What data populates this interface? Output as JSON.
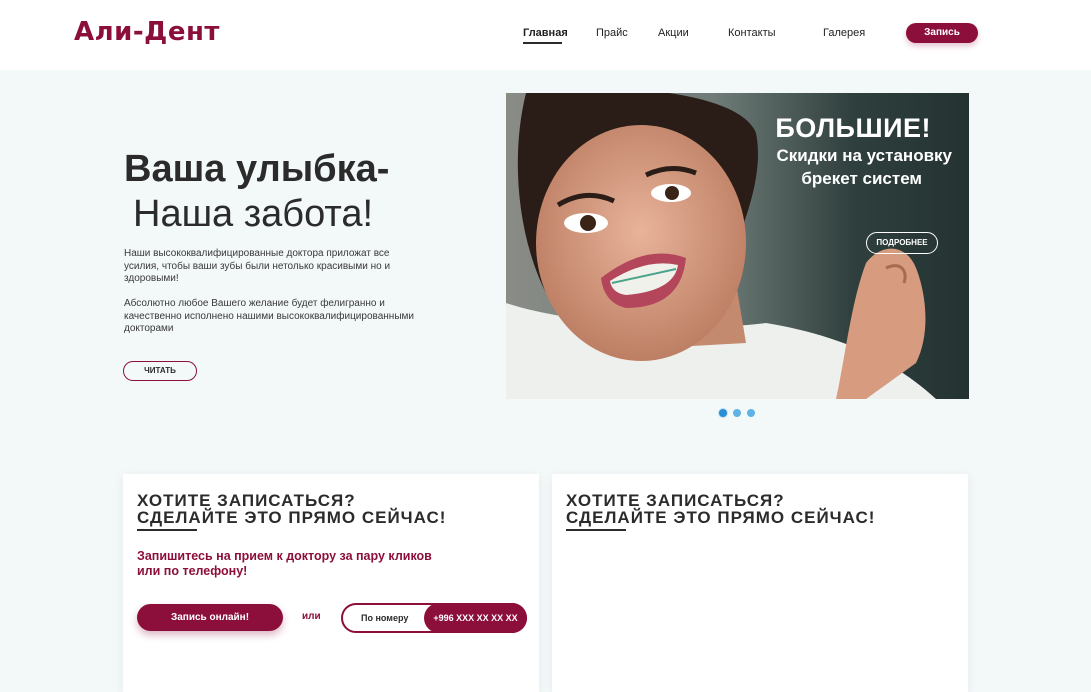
{
  "header": {
    "logo": "Али-Дент",
    "nav": [
      "Главная",
      "Прайс",
      "Акции",
      "Контакты",
      "Галерея"
    ],
    "cta": "Запись"
  },
  "hero": {
    "title_line1": "Ваша улыбка-",
    "title_line2": "Наша забота!",
    "paragraph1": "Наши высококвалифицированные доктора приложат все усилия, чтобы ваши зубы были нетолько красивыми но и здоровыми!",
    "paragraph2": "Абсолютно любое Вашего желание будет фелигранно и качественно исполнено нашими высококвалифицированными докторами",
    "read_button": "ЧИТАТЬ"
  },
  "banner": {
    "title": "БОЛЬШИЕ!",
    "subtitle_line1": "Скидки на установку",
    "subtitle_line2": "брекет систем",
    "more_button": "ПОДРОБНЕЕ",
    "slides_total": 3,
    "active_slide": 1
  },
  "card_left": {
    "heading_line1": "ХОТИТЕ ЗАПИСАТЬСЯ?",
    "heading_line2": "СДЕЛАЙТЕ ЭТО ПРЯМО СЕЙЧАС!",
    "text": "Запишитесь на прием к доктору за пару кликов или по телефону!",
    "online_button": "Запись онлайн!",
    "or_label": "или",
    "phone_label": "По номеру",
    "phone_number": "+996 XXX XX XX XX"
  },
  "card_right": {
    "heading_line1": "ХОТИТЕ ЗАПИСАТЬСЯ?",
    "heading_line2": "СДЕЛАЙТЕ ЭТО ПРЯМО СЕЙЧАС!"
  },
  "colors": {
    "brand": "#8c0f3b",
    "background": "#f3f8f9",
    "dot": "#5fb3e6"
  }
}
